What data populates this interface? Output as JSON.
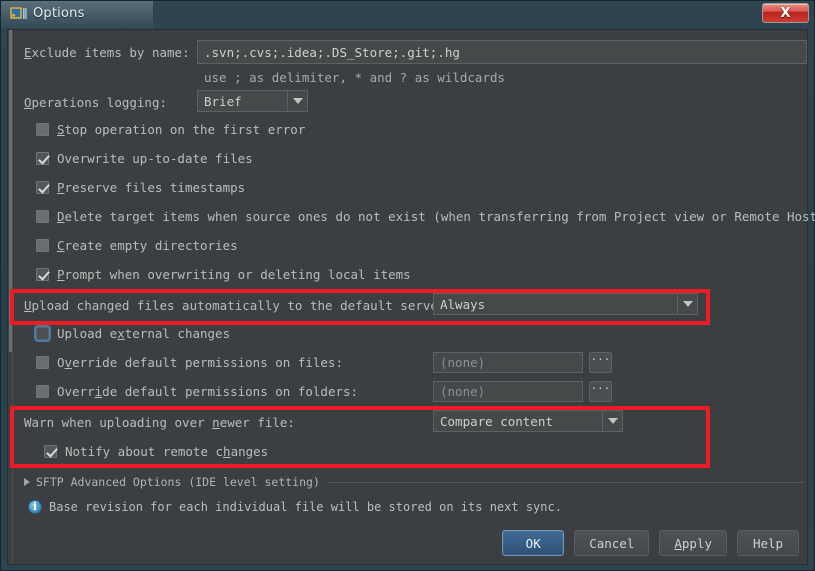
{
  "window": {
    "title": "Options",
    "app_icon": "jetbrains-logo-icon",
    "close_label": "X"
  },
  "form": {
    "exclude": {
      "label_pre": "E",
      "label_post": "xclude items by name:",
      "value": ".svn;.cvs;.idea;.DS_Store;.git;.hg",
      "hint": "use ; as delimiter, * and ? as wildcards"
    },
    "logging": {
      "label_pre": "O",
      "label_post": "perations logging:",
      "value": "Brief"
    },
    "checkboxes": [
      {
        "id": "stop-operation",
        "pre": "S",
        "post": "top operation on the first error",
        "checked": false,
        "focused": false
      },
      {
        "id": "overwrite-up-to-date",
        "pre": "Overw",
        "post": "rite up-to-date files",
        "checked": true,
        "focused": false,
        "underline_index": 5
      },
      {
        "id": "preserve-timestamps",
        "pre": "P",
        "post": "reserve files timestamps",
        "checked": true,
        "focused": false
      },
      {
        "id": "delete-target-items",
        "pre": "D",
        "post": "elete target items when source ones do not exist (when transferring from Project view or Remote Host view)",
        "checked": false,
        "focused": false
      },
      {
        "id": "create-empty-directories",
        "pre": "C",
        "post": "reate empty directories",
        "checked": false,
        "focused": false
      },
      {
        "id": "prompt-overwriting",
        "pre": "P",
        "post": "rompt when overwriting or deleting local items",
        "checked": true,
        "focused": false
      }
    ],
    "upload_auto": {
      "label_first": "U",
      "label_rest": "pload changed files automatically to the default server",
      "value": "Always"
    },
    "upload_external": {
      "label_a": "Upload e",
      "label_u": "x",
      "label_b": "ternal changes",
      "checked": false,
      "focused": true
    },
    "perm_files": {
      "label_a": "O",
      "label_u": "v",
      "label_b": "erride default permissions on files:",
      "checked": false,
      "value": "(none)",
      "browse": "···"
    },
    "perm_folders": {
      "label_a": "Overr",
      "label_u": "i",
      "label_b": "de default permissions on folders:",
      "checked": false,
      "value": "(none)",
      "browse": "···"
    },
    "warn_newer": {
      "label_a": "Warn when uploading over ",
      "label_u": "n",
      "label_b": "ewer file:",
      "value": "Compare content"
    },
    "notify_remote": {
      "label_a": "Notify about remote c",
      "label_u": "h",
      "label_b": "anges",
      "checked": true
    },
    "advanced_section": {
      "label": "SFTP Advanced Options (IDE level setting)"
    },
    "info_note": {
      "text": "Base revision for each individual file will be stored on its next sync."
    }
  },
  "buttons": {
    "ok": "OK",
    "cancel": "Cancel",
    "apply_pre": "A",
    "apply_post": "pply",
    "help": "Help"
  },
  "annotations": {
    "highlight_color": "#ed1c24",
    "box_count": 2
  }
}
